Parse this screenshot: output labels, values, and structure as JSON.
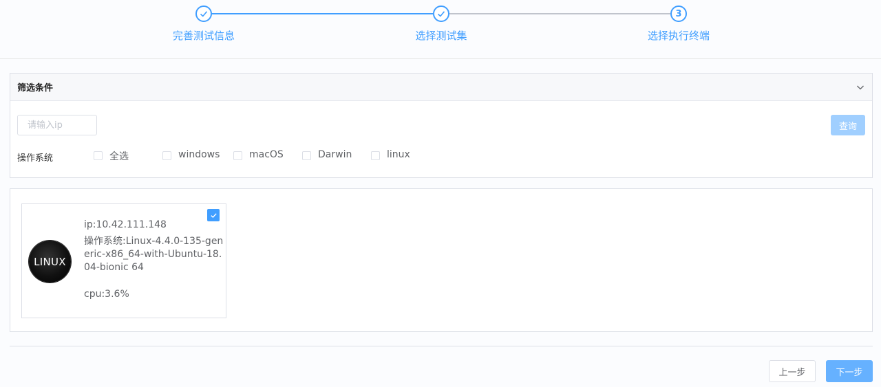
{
  "steps": [
    {
      "title": "完善测试信息",
      "status": "done"
    },
    {
      "title": "选择测试集",
      "status": "done"
    },
    {
      "title": "选择执行终端",
      "status": "active",
      "number": "3"
    }
  ],
  "filter": {
    "title": "筛选条件",
    "ip_placeholder": "请输入ip",
    "query_label": "查询",
    "os_label": "操作系统",
    "os_options": [
      {
        "label": "全选",
        "checked": false
      },
      {
        "label": "windows",
        "checked": false
      },
      {
        "label": "macOS",
        "checked": false
      },
      {
        "label": "Darwin",
        "checked": false
      },
      {
        "label": "linux",
        "checked": false
      }
    ]
  },
  "terminals": [
    {
      "logo_text": "LINUX",
      "ip": "ip:10.42.111.148",
      "os": "操作系统:Linux-4.4.0-135-generic-x86_64-with-Ubuntu-18.04-bionic 64",
      "cpu": "cpu:3.6%",
      "checked": true
    }
  ],
  "footer": {
    "prev_label": "上一步",
    "next_label": "下一步"
  },
  "colors": {
    "accent": "#409eff",
    "accent_light": "#a0cfff",
    "next_button": "#66b1ff",
    "pending_line": "#c0c4cc"
  }
}
